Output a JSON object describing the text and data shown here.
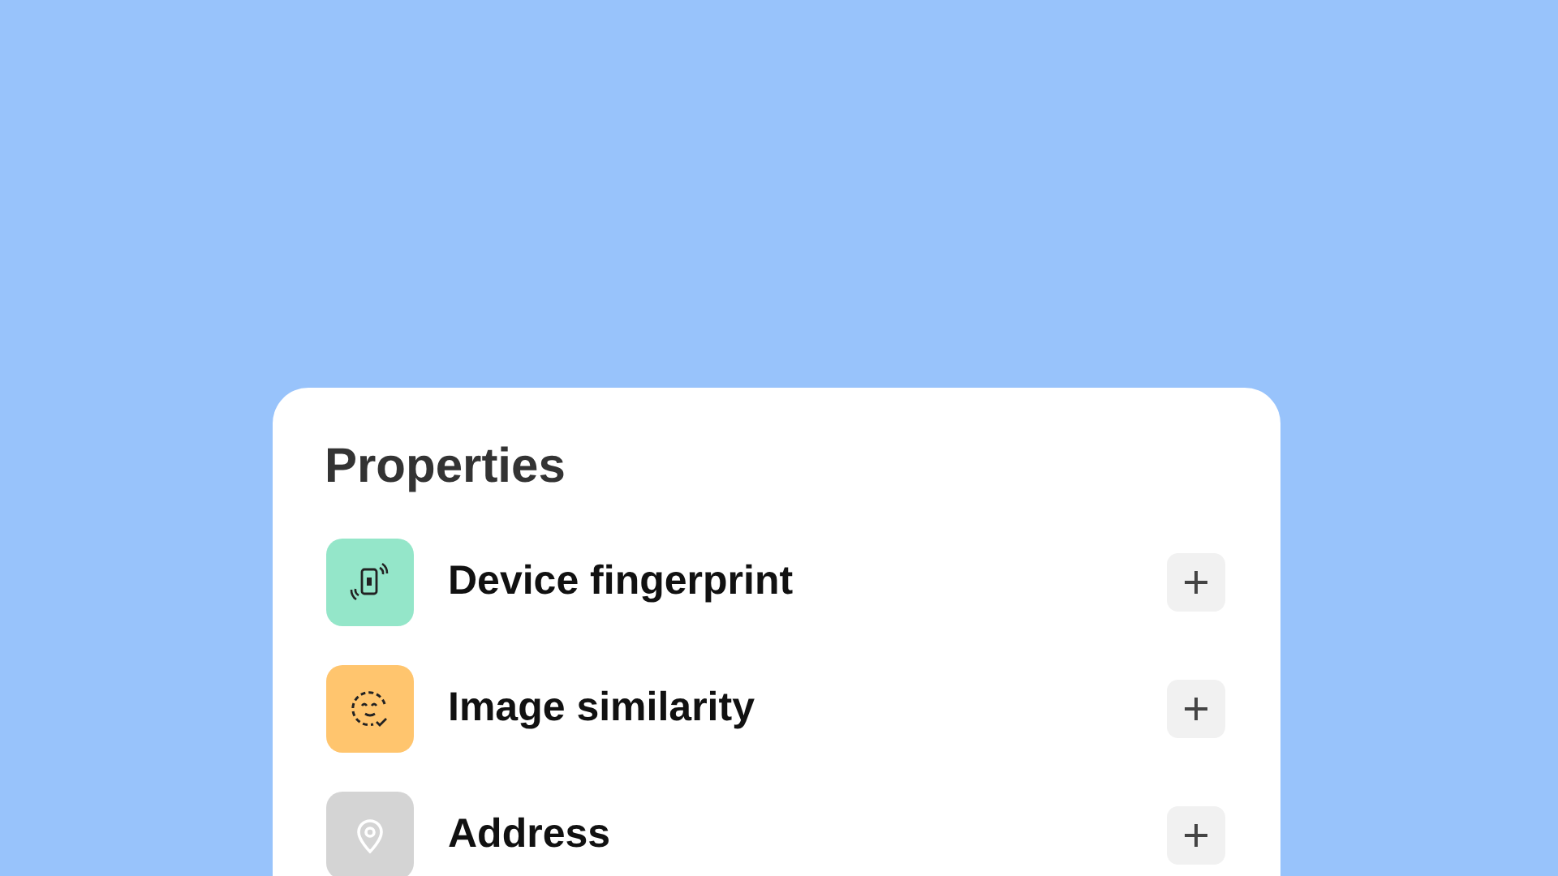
{
  "panel": {
    "title": "Properties",
    "items": [
      {
        "label": "Device fingerprint",
        "kind": "device",
        "color": "#94e6c9"
      },
      {
        "label": "Image similarity",
        "kind": "face",
        "color": "#ffc56e"
      },
      {
        "label": "Address",
        "kind": "pin",
        "color": "#d4d4d4"
      }
    ]
  }
}
